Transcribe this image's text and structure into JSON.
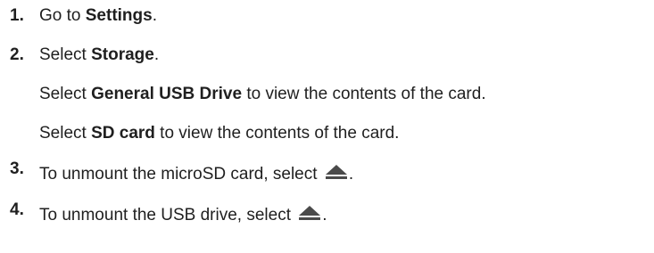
{
  "steps": [
    {
      "number": "1.",
      "prefix": "Go to ",
      "bold": "Settings",
      "suffix": "."
    },
    {
      "number": "2.",
      "prefix": "Select ",
      "bold": "Storage",
      "suffix": "."
    },
    {
      "number": "",
      "prefix": "Select ",
      "bold": "General USB Drive",
      "suffix": " to view the contents of the card."
    },
    {
      "number": "",
      "prefix": "Select ",
      "bold": "SD card",
      "suffix": " to view the contents of the card."
    },
    {
      "number": "3.",
      "prefix": "To unmount the microSD card, select ",
      "bold": "",
      "suffix": ".",
      "icon": "eject-icon"
    },
    {
      "number": "4.",
      "prefix": "To unmount the USB drive, select ",
      "bold": "",
      "suffix": ".",
      "icon": "eject-icon"
    }
  ],
  "colors": {
    "text": "#1f1f1f",
    "icon": "#4a4a4a"
  }
}
